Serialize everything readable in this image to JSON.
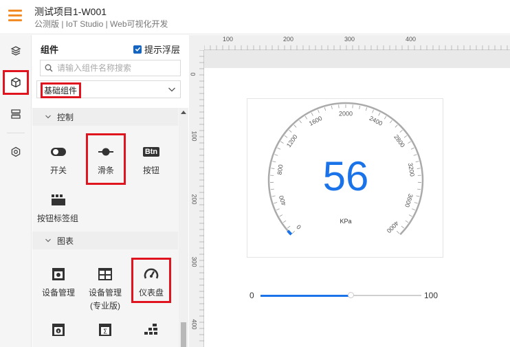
{
  "header": {
    "title": "测试项目1-W001",
    "subtitle": "公测版 | IoT Studio | Web可视化开发"
  },
  "iconrail": {
    "items": [
      {
        "name": "layers-icon"
      },
      {
        "name": "components-cube-icon",
        "selected": true
      },
      {
        "name": "pages-icon"
      },
      {
        "name": "settings-hex-icon"
      }
    ]
  },
  "panel": {
    "title": "组件",
    "hint_label": "提示浮层",
    "hint_checked": true,
    "search_placeholder": "请输入组件名称搜索",
    "category_selected": "基础组件",
    "sections": [
      {
        "label": "控制",
        "items": [
          {
            "label": "开关",
            "icon": "switch-icon"
          },
          {
            "label": "滑条",
            "icon": "slider-icon",
            "highlighted": true
          },
          {
            "label": "按钮",
            "icon": "button-icon",
            "icon_text": "Btn"
          },
          {
            "label": "按钮标签组",
            "icon": "button-tab-group-icon"
          }
        ]
      },
      {
        "label": "图表",
        "items": [
          {
            "label": "设备管理",
            "icon": "device-manage-icon"
          },
          {
            "label": "设备管理\n(专业版)",
            "label_line1": "设备管理",
            "label_line2": "(专业版)",
            "icon": "device-manage-pro-icon"
          },
          {
            "label": "仪表盘",
            "icon": "gauge-icon",
            "highlighted": true
          },
          {
            "label": "",
            "icon": "info-card-icon"
          },
          {
            "label": "",
            "icon": "sum-card-icon"
          },
          {
            "label": "",
            "icon": "bar-blocks-icon"
          }
        ]
      }
    ]
  },
  "ruler": {
    "top": [
      "100",
      "200",
      "300",
      "400"
    ],
    "left": [
      "0",
      "100",
      "200",
      "300",
      "400"
    ]
  },
  "gauge": {
    "value": "56",
    "unit": "KPa",
    "min": 0,
    "max": 4000,
    "ticks": [
      "0",
      "400",
      "800",
      "1200",
      "1600",
      "2000",
      "2400",
      "2800",
      "3200",
      "3600",
      "4000"
    ],
    "accent": "#1a73e8"
  },
  "slider": {
    "min_label": "0",
    "max_label": "100",
    "value": 56
  },
  "colors": {
    "accent": "#f28c28",
    "primary": "#1a73e8",
    "highlight": "#e0141e"
  }
}
